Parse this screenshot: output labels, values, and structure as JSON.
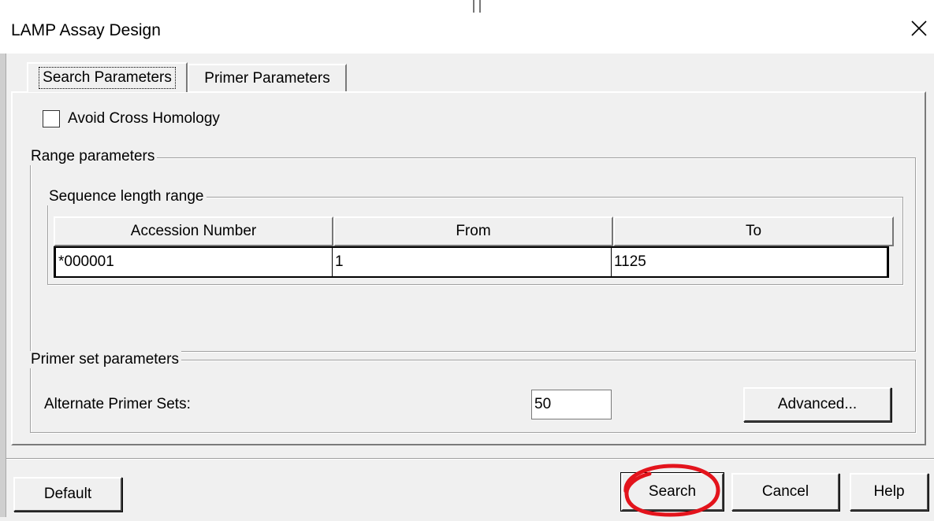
{
  "window": {
    "title": "LAMP Assay Design"
  },
  "tabs": [
    {
      "label": "Search Parameters",
      "active": true
    },
    {
      "label": "Primer Parameters",
      "active": false
    }
  ],
  "search": {
    "avoid_cross_homology": {
      "label": "Avoid Cross Homology",
      "checked": false
    },
    "range_group": "Range parameters",
    "sequence_group": "Sequence length range",
    "table": {
      "columns": [
        "Accession Number",
        "From",
        "To"
      ],
      "rows": [
        [
          "*000001",
          "1",
          "1125"
        ]
      ]
    },
    "primer_group": "Primer set parameters",
    "alternate_label": "Alternate Primer Sets:",
    "alternate_value": "50",
    "advanced_button": "Advanced..."
  },
  "buttons": {
    "default": "Default",
    "search": "Search",
    "cancel": "Cancel",
    "help": "Help"
  },
  "icons": {
    "close": "close-icon"
  },
  "colors": {
    "annotation": "#e3141c",
    "dialog_bg": "#f0f0f0"
  }
}
